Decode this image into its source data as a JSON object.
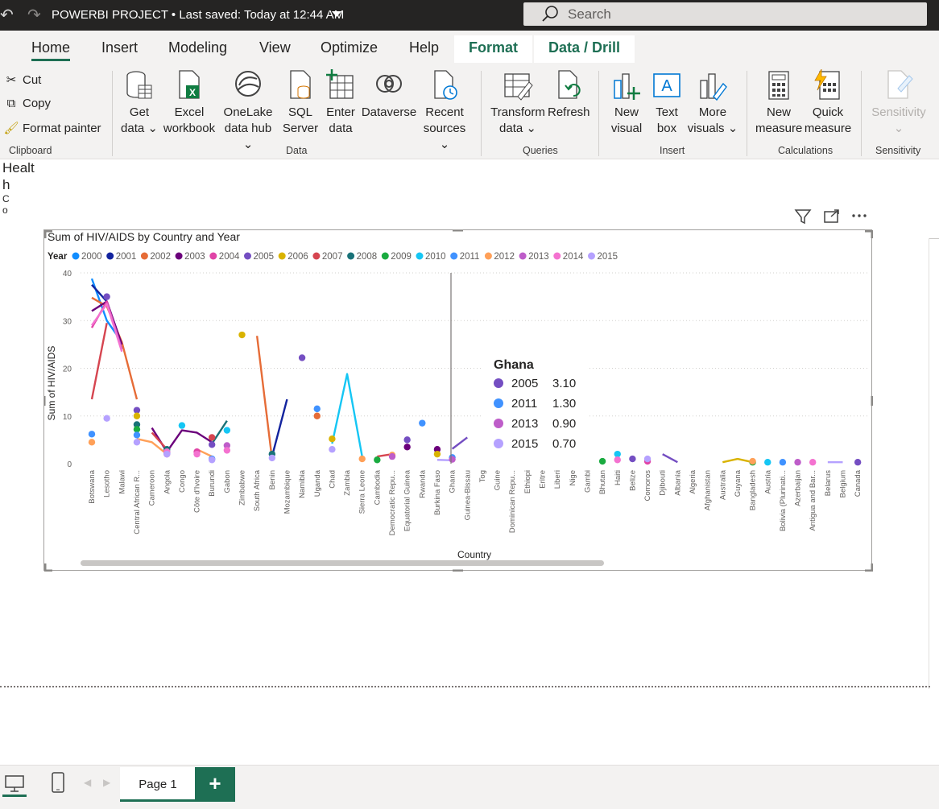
{
  "titlebar": {
    "title": "POWERBI PROJECT • Last saved: Today at 12:44 AM",
    "search_placeholder": "Search"
  },
  "tabs": [
    "Home",
    "Insert",
    "Modeling",
    "View",
    "Optimize",
    "Help"
  ],
  "context_tabs": [
    "Format",
    "Data / Drill"
  ],
  "ribbon": {
    "clipboard": {
      "cut": "Cut",
      "copy": "Copy",
      "format_painter": "Format painter",
      "label": "Clipboard"
    },
    "data": {
      "label": "Data",
      "get_data": [
        "Get",
        "data"
      ],
      "excel": [
        "Excel",
        "workbook"
      ],
      "onelake": [
        "OneLake",
        "data hub"
      ],
      "sql": [
        "SQL",
        "Server"
      ],
      "enter": [
        "Enter",
        "data"
      ],
      "dataverse": "Dataverse",
      "recent": [
        "Recent",
        "sources"
      ]
    },
    "queries": {
      "label": "Queries",
      "transform": [
        "Transform",
        "data"
      ],
      "refresh": "Refresh"
    },
    "insert": {
      "label": "Insert",
      "new_visual": [
        "New",
        "visual"
      ],
      "text_box": [
        "Text",
        "box"
      ],
      "more_visuals": [
        "More",
        "visuals"
      ]
    },
    "calculations": {
      "label": "Calculations",
      "new_measure": [
        "New",
        "measure"
      ],
      "quick_measure": [
        "Quick",
        "measure"
      ]
    },
    "sensitivity": {
      "label": "Sensitivity",
      "button": "Sensitivity"
    }
  },
  "canvas": {
    "left_text": [
      "Healt",
      "h",
      "C",
      "o"
    ]
  },
  "chart_data": {
    "type": "line",
    "title": "Sum of HIV/AIDS by Country and Year",
    "legend_title": "Year",
    "legend_position": "top-left",
    "xlabel": "Country",
    "ylabel": "Sum of HIV/AIDS",
    "ylim": [
      0,
      40
    ],
    "yticks": [
      0,
      10,
      20,
      30,
      40
    ],
    "grid": true,
    "categories": [
      "Botswana",
      "Lesotho",
      "Malawi",
      "Central African R...",
      "Cameroon",
      "Angola",
      "Congo",
      "Côte d'Ivoire",
      "Burundi",
      "Gabon",
      "Zimbabwe",
      "South Africa",
      "Benin",
      "Mozambique",
      "Namibia",
      "Uganda",
      "Chad",
      "Zambia",
      "Sierra Leone",
      "Cambodia",
      "Democratic Repu...",
      "Equatorial Guinea",
      "Rwanda",
      "Burkina Faso",
      "Ghana",
      "Guinea-Bissau",
      "Tog",
      "Guine",
      "Dominican Repu...",
      "Ethiopi",
      "Eritre",
      "Liberi",
      "Nige",
      "Gambi",
      "Bhutan",
      "Haiti",
      "Belize",
      "Comoros",
      "Djibouti",
      "Albania",
      "Algeria",
      "Afghanistan",
      "Australia",
      "Guyana",
      "Bangladesh",
      "Austria",
      "Bolivia (Plurinati...",
      "Azerbaijan",
      "Antigua and Bar...",
      "Belarus",
      "Belgium",
      "Canada"
    ],
    "series": [
      {
        "name": "2000",
        "color": "#118dff",
        "values": [
          {
            "i": 0,
            "v": 38.8
          },
          {
            "i": 1,
            "v": 30
          },
          {
            "i": 2,
            "v": 25.5
          }
        ]
      },
      {
        "name": "2001",
        "color": "#12239e",
        "values": [
          {
            "i": 0,
            "v": 37.5
          },
          {
            "i": 1,
            "v": 34
          },
          {
            "i": 2,
            "v": 25
          },
          {
            "i": 12,
            "v": 1.5
          },
          {
            "i": 13,
            "v": 13.5
          }
        ]
      },
      {
        "name": "2002",
        "color": "#e66c37",
        "values": [
          {
            "i": 0,
            "v": 34.8
          },
          {
            "i": 1,
            "v": 33
          },
          {
            "i": 2,
            "v": 25.5
          },
          {
            "i": 3,
            "v": 13.5
          },
          {
            "i": 11,
            "v": 26.8
          },
          {
            "i": 12,
            "v": 1
          },
          {
            "i": 15,
            "v": 10
          }
        ]
      },
      {
        "name": "2003",
        "color": "#6b007b",
        "values": [
          {
            "i": 0,
            "v": 32
          },
          {
            "i": 1,
            "v": 34
          },
          {
            "i": 2,
            "v": 25
          },
          {
            "i": 4,
            "v": 7.5
          },
          {
            "i": 5,
            "v": 2.5
          },
          {
            "i": 6,
            "v": 7
          },
          {
            "i": 7,
            "v": 6.5
          },
          {
            "i": 8,
            "v": 4.5
          },
          {
            "i": 21,
            "v": 3.5
          },
          {
            "i": 23,
            "v": 3
          }
        ]
      },
      {
        "name": "2004",
        "color": "#e044a7",
        "values": [
          {
            "i": 0,
            "v": 28.5
          },
          {
            "i": 1,
            "v": 34
          },
          {
            "i": 2,
            "v": 24
          },
          {
            "i": 5,
            "v": 2
          },
          {
            "i": 7,
            "v": 2.5
          },
          {
            "i": 37,
            "v": 0.5
          }
        ]
      },
      {
        "name": "2005",
        "color": "#744ec2",
        "values": [
          {
            "i": 1,
            "v": 35
          },
          {
            "i": 3,
            "v": 11.2
          },
          {
            "i": 5,
            "v": 2.5
          },
          {
            "i": 8,
            "v": 4
          },
          {
            "i": 14,
            "v": 22.2
          },
          {
            "i": 21,
            "v": 5
          },
          {
            "i": 24,
            "v": 3.1
          },
          {
            "i": 25,
            "v": 5.5
          },
          {
            "i": 36,
            "v": 1
          },
          {
            "i": 38,
            "v": 2
          },
          {
            "i": 39,
            "v": 0.3
          },
          {
            "i": 51,
            "v": 0.3
          }
        ]
      },
      {
        "name": "2006",
        "color": "#d9b300",
        "values": [
          {
            "i": 3,
            "v": 10
          },
          {
            "i": 10,
            "v": 27
          },
          {
            "i": 16,
            "v": 5.2
          },
          {
            "i": 23,
            "v": 2
          },
          {
            "i": 42,
            "v": 0.3
          },
          {
            "i": 43,
            "v": 1
          },
          {
            "i": 44,
            "v": 0.3
          }
        ]
      },
      {
        "name": "2007",
        "color": "#d64550",
        "values": [
          {
            "i": 0,
            "v": 13.5
          },
          {
            "i": 1,
            "v": 29.5
          },
          {
            "i": 4,
            "v": 6.5
          },
          {
            "i": 5,
            "v": 3
          },
          {
            "i": 8,
            "v": 5.5
          },
          {
            "i": 19,
            "v": 1.5
          },
          {
            "i": 20,
            "v": 2
          }
        ]
      },
      {
        "name": "2008",
        "color": "#197278",
        "values": [
          {
            "i": 3,
            "v": 8.2
          },
          {
            "i": 5,
            "v": 3
          },
          {
            "i": 8,
            "v": 4.2
          },
          {
            "i": 9,
            "v": 9
          },
          {
            "i": 12,
            "v": 2
          }
        ]
      },
      {
        "name": "2009",
        "color": "#1aab40",
        "values": [
          {
            "i": 3,
            "v": 7.2
          },
          {
            "i": 19,
            "v": 0.8
          },
          {
            "i": 34,
            "v": 0.5
          },
          {
            "i": 44,
            "v": 0.3
          }
        ]
      },
      {
        "name": "2010",
        "color": "#15c6f4",
        "values": [
          {
            "i": 6,
            "v": 8
          },
          {
            "i": 9,
            "v": 7
          },
          {
            "i": 16,
            "v": 4.2
          },
          {
            "i": 17,
            "v": 18.8
          },
          {
            "i": 18,
            "v": 1.5
          },
          {
            "i": 35,
            "v": 2
          },
          {
            "i": 45,
            "v": 0.3
          }
        ]
      },
      {
        "name": "2011",
        "color": "#4092ff",
        "values": [
          {
            "i": 0,
            "v": 6.2
          },
          {
            "i": 3,
            "v": 6
          },
          {
            "i": 5,
            "v": 2.2
          },
          {
            "i": 8,
            "v": 1
          },
          {
            "i": 15,
            "v": 11.5
          },
          {
            "i": 22,
            "v": 8.5
          },
          {
            "i": 24,
            "v": 1.3
          },
          {
            "i": 46,
            "v": 0.3
          }
        ]
      },
      {
        "name": "2012",
        "color": "#ffa058",
        "values": [
          {
            "i": 0,
            "v": 4.5
          },
          {
            "i": 3,
            "v": 5.2
          },
          {
            "i": 4,
            "v": 4.5
          },
          {
            "i": 5,
            "v": 2
          },
          {
            "i": 7,
            "v": 3
          },
          {
            "i": 8,
            "v": 1.5
          },
          {
            "i": 18,
            "v": 1
          },
          {
            "i": 20,
            "v": 1.8
          },
          {
            "i": 44,
            "v": 0.5
          }
        ]
      },
      {
        "name": "2013",
        "color": "#be5dc9",
        "values": [
          {
            "i": 1,
            "v": 33.5
          },
          {
            "i": 2,
            "v": 24
          },
          {
            "i": 9,
            "v": 3.8
          },
          {
            "i": 20,
            "v": 1.5
          },
          {
            "i": 24,
            "v": 0.9
          },
          {
            "i": 47,
            "v": 0.3
          }
        ]
      },
      {
        "name": "2014",
        "color": "#f472d0",
        "values": [
          {
            "i": 0,
            "v": 29
          },
          {
            "i": 1,
            "v": 33.5
          },
          {
            "i": 2,
            "v": 23.5
          },
          {
            "i": 5,
            "v": 2.5
          },
          {
            "i": 7,
            "v": 2
          },
          {
            "i": 9,
            "v": 2.8
          },
          {
            "i": 35,
            "v": 0.8
          },
          {
            "i": 48,
            "v": 0.3
          }
        ]
      },
      {
        "name": "2015",
        "color": "#b5a1ff",
        "values": [
          {
            "i": 1,
            "v": 9.5
          },
          {
            "i": 3,
            "v": 4.5
          },
          {
            "i": 5,
            "v": 2
          },
          {
            "i": 8,
            "v": 0.8
          },
          {
            "i": 12,
            "v": 1.2
          },
          {
            "i": 16,
            "v": 3
          },
          {
            "i": 23,
            "v": 0.8
          },
          {
            "i": 24,
            "v": 0.7
          },
          {
            "i": 37,
            "v": 1
          },
          {
            "i": 49,
            "v": 0.3
          },
          {
            "i": 50,
            "v": 0.3
          }
        ]
      }
    ],
    "tooltip": {
      "country": "Ghana",
      "rows": [
        {
          "year": "2005",
          "value": "3.10",
          "color": "#744ec2"
        },
        {
          "year": "2011",
          "value": "1.30",
          "color": "#4092ff"
        },
        {
          "year": "2013",
          "value": "0.90",
          "color": "#be5dc9"
        },
        {
          "year": "2015",
          "value": "0.70",
          "color": "#b5a1ff"
        }
      ]
    }
  },
  "pagebar": {
    "page_tab": "Page 1",
    "add": "+"
  },
  "colors": {
    "accent": "#1e6f54",
    "titlebar": "#252423"
  }
}
